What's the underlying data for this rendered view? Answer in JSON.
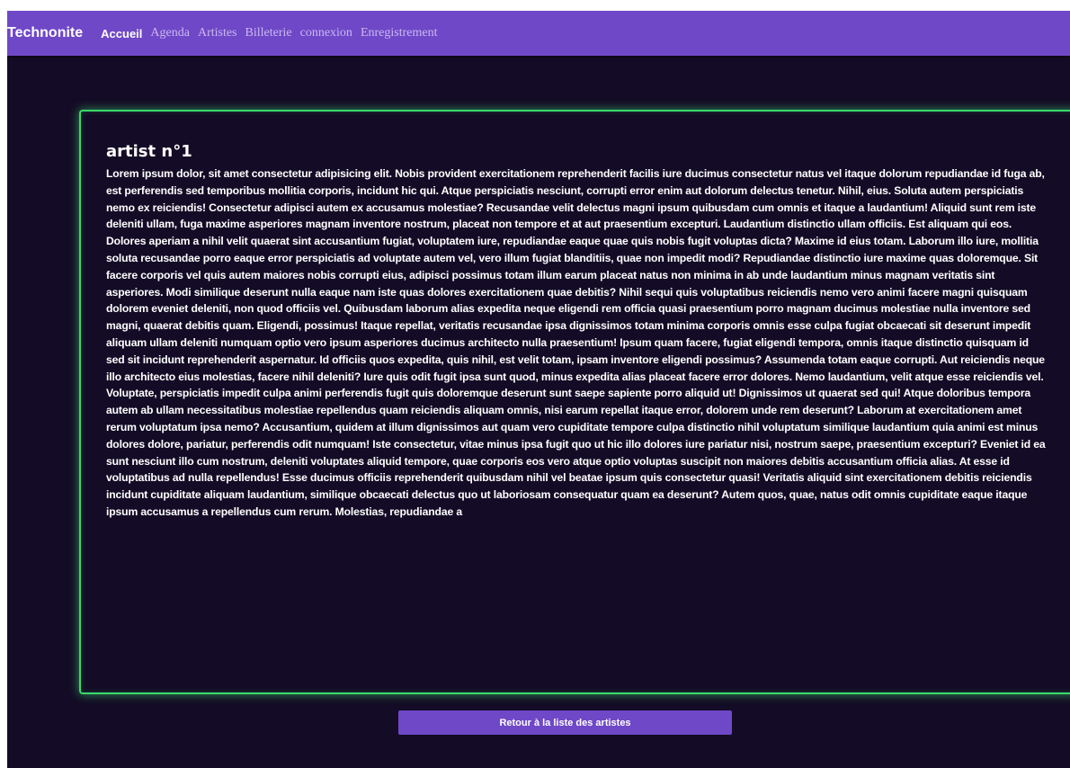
{
  "navbar": {
    "brand": "Technonite",
    "links": [
      {
        "label": "Accueil",
        "active": true
      },
      {
        "label": "Agenda"
      },
      {
        "label": "Artistes"
      },
      {
        "label": "Billeterie"
      },
      {
        "label": "connexion"
      },
      {
        "label": "Enregistrement"
      }
    ]
  },
  "artist": {
    "title": "artist n°1",
    "description": "Lorem ipsum dolor, sit amet consectetur adipisicing elit. Nobis provident exercitationem reprehenderit facilis iure ducimus consectetur natus vel itaque dolorum repudiandae id fuga ab, est perferendis sed temporibus mollitia corporis, incidunt hic qui. Atque perspiciatis nesciunt, corrupti error enim aut dolorum delectus tenetur. Nihil, eius. Soluta autem perspiciatis nemo ex reiciendis! Consectetur adipisci autem ex accusamus molestiae? Recusandae velit delectus magni ipsum quibusdam cum omnis et itaque a laudantium! Aliquid sunt rem iste deleniti ullam, fuga maxime asperiores magnam inventore nostrum, placeat non tempore et at aut praesentium excepturi. Laudantium distinctio ullam officiis. Est aliquam qui eos. Dolores aperiam a nihil velit quaerat sint accusantium fugiat, voluptatem iure, repudiandae eaque quae quis nobis fugit voluptas dicta? Maxime id eius totam. Laborum illo iure, mollitia soluta recusandae porro eaque error perspiciatis ad voluptate autem vel, vero illum fugiat blanditiis, quae non impedit modi? Repudiandae distinctio iure maxime quas doloremque. Sit facere corporis vel quis autem maiores nobis corrupti eius, adipisci possimus totam illum earum placeat natus non minima in ab unde laudantium minus magnam veritatis sint asperiores. Modi similique deserunt nulla eaque nam iste quas dolores exercitationem quae debitis? Nihil sequi quis voluptatibus reiciendis nemo vero animi facere magni quisquam dolorem eveniet deleniti, non quod officiis vel. Quibusdam laborum alias expedita neque eligendi rem officia quasi praesentium porro magnam ducimus molestiae nulla inventore sed magni, quaerat debitis quam. Eligendi, possimus! Itaque repellat, veritatis recusandae ipsa dignissimos totam minima corporis omnis esse culpa fugiat obcaecati sit deserunt impedit aliquam ullam deleniti numquam optio vero ipsum asperiores ducimus architecto nulla praesentium! Ipsum quam facere, fugiat eligendi tempora, omnis itaque distinctio quisquam id sed sit incidunt reprehenderit aspernatur. Id officiis quos expedita, quis nihil, est velit totam, ipsam inventore eligendi possimus? Assumenda totam eaque corrupti. Aut reiciendis neque illo architecto eius molestias, facere nihil deleniti? Iure quis odit fugit ipsa sunt quod, minus expedita alias placeat facere error dolores. Nemo laudantium, velit atque esse reiciendis vel. Voluptate, perspiciatis impedit culpa animi perferendis fugit quis doloremque deserunt sunt saepe sapiente porro aliquid ut! Dignissimos ut quaerat sed qui! Atque doloribus tempora autem ab ullam necessitatibus molestiae repellendus quam reiciendis aliquam omnis, nisi earum repellat itaque error, dolorem unde rem deserunt? Laborum at exercitationem amet rerum voluptatum ipsa nemo? Accusantium, quidem at illum dignissimos aut quam vero cupiditate tempore culpa distinctio nihil voluptatum similique laudantium quia animi est minus dolores dolore, pariatur, perferendis odit numquam! Iste consectetur, vitae minus ipsa fugit quo ut hic illo dolores iure pariatur nisi, nostrum saepe, praesentium excepturi? Eveniet id ea sunt nesciunt illo cum nostrum, deleniti voluptates aliquid tempore, quae corporis eos vero atque optio voluptas suscipit non maiores debitis accusantium officia alias. At esse id voluptatibus ad nulla repellendus! Esse ducimus officiis reprehenderit quibusdam nihil vel beatae ipsum quis consectetur quasi! Veritatis aliquid sint exercitationem debitis reiciendis incidunt cupiditate aliquam laudantium, similique obcaecati delectus quo ut laboriosam consequatur quam ea deserunt? Autem quos, quae, natus odit omnis cupiditate eaque itaque ipsum accusamus a repellendus cum rerum. Molestias, repudiandae a"
  },
  "back_button": {
    "label": "Retour à la liste des artistes"
  },
  "colors": {
    "navbar": "#6f48c7",
    "background": "#140c26",
    "card_border": "#39d96b",
    "button": "#6f48c7"
  }
}
